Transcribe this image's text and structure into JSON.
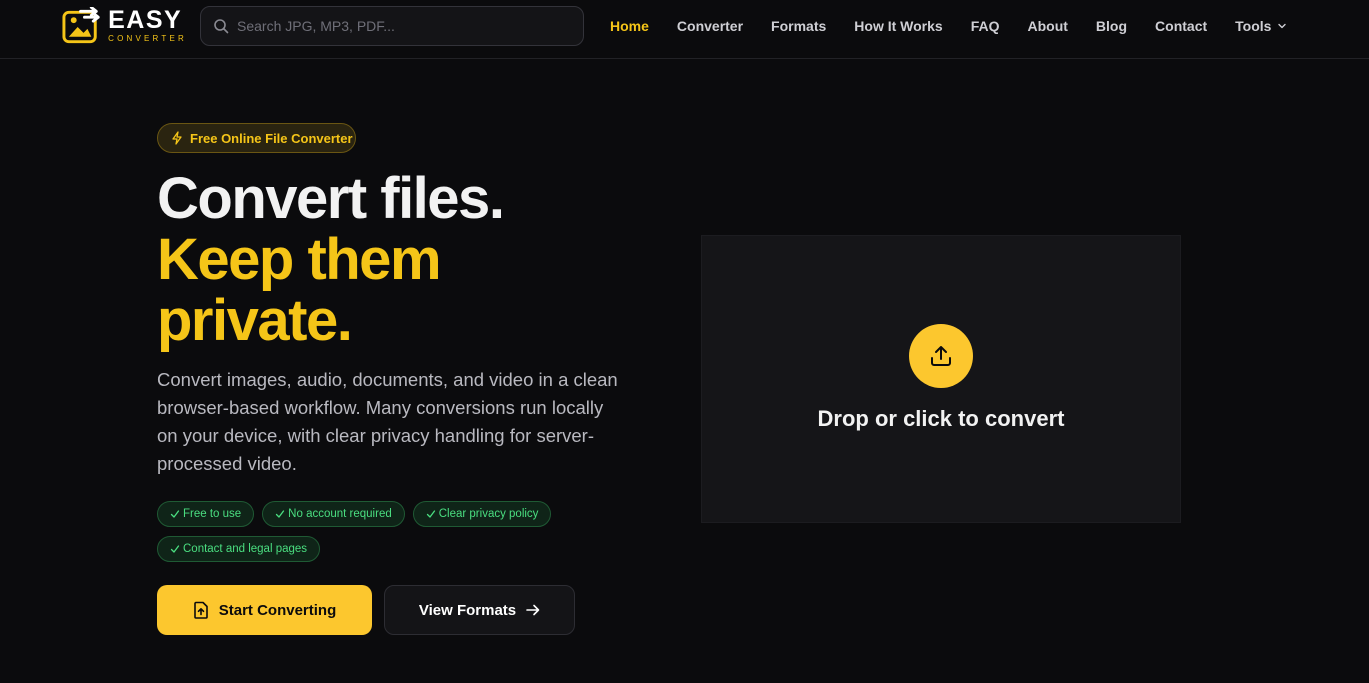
{
  "brand": {
    "name": "EASY",
    "tagline": "CONVERTER",
    "accent": "#f5c518"
  },
  "search": {
    "placeholder": "Search JPG, MP3, PDF..."
  },
  "nav": {
    "items": [
      {
        "label": "Home",
        "active": true
      },
      {
        "label": "Converter"
      },
      {
        "label": "Formats"
      },
      {
        "label": "How It Works"
      },
      {
        "label": "FAQ"
      },
      {
        "label": "About"
      },
      {
        "label": "Blog"
      },
      {
        "label": "Contact"
      },
      {
        "label": "Tools",
        "icon": "chevron-down-icon"
      }
    ]
  },
  "hero": {
    "badge": "Free Online File Converter",
    "headline_line1": "Convert files.",
    "headline_line2": "Keep them",
    "headline_line3": "private.",
    "lead": "Convert images, audio, documents, and video in a clean browser-based workflow. Many conversions run locally on your device, with clear privacy handling for server-processed video.",
    "chips": [
      "Free to use",
      "No account required",
      "Clear privacy policy",
      "Contact and legal pages"
    ],
    "primary_button": "Start Converting",
    "secondary_button": "View Formats"
  },
  "dropzone": {
    "label": "Drop or click to convert",
    "icon": "upload-icon"
  }
}
